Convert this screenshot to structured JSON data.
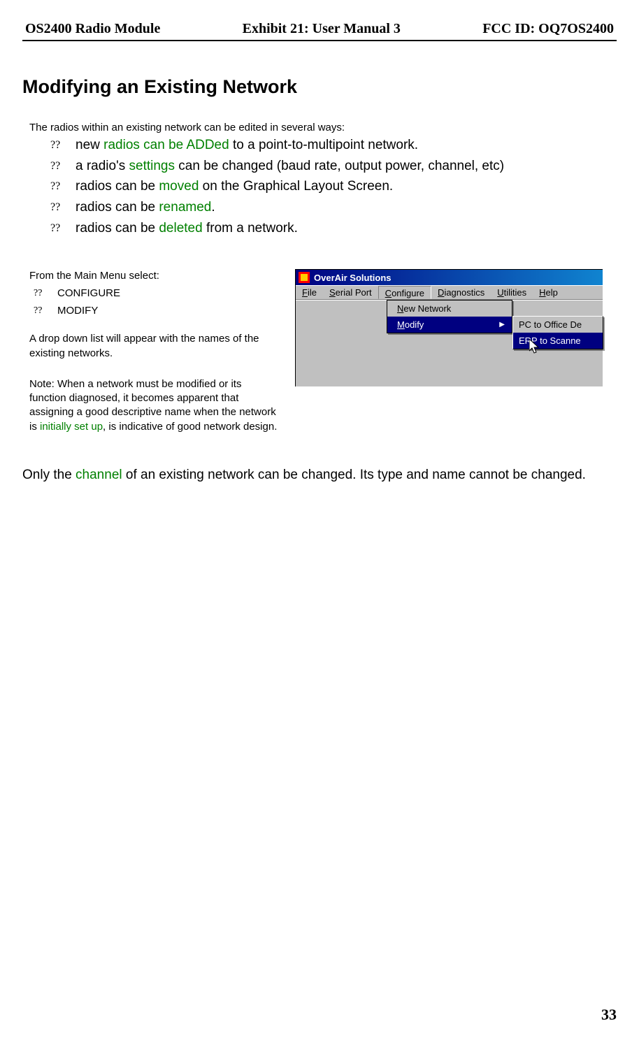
{
  "header": {
    "left": "OS2400 Radio Module",
    "center": "Exhibit 21: User Manual 3",
    "right": "FCC ID: OQ7OS2400"
  },
  "title": "Modifying an Existing Network",
  "intro": "The radios within an existing network can be edited in several ways:",
  "bullets": [
    {
      "marker": "??",
      "pre": "new ",
      "link": "radios can be ADDed",
      "post": " to a point-to-multipoint network."
    },
    {
      "marker": "??",
      "pre": "a radio's ",
      "link": "settings",
      "post": " can be changed (baud rate, output power, channel, etc)"
    },
    {
      "marker": "??",
      "pre": "radios can be ",
      "link": "moved",
      "post": " on the Graphical Layout Screen."
    },
    {
      "marker": "??",
      "pre": "radios can be ",
      "link": "renamed",
      "post": "."
    },
    {
      "marker": "??",
      "pre": "radios can be ",
      "link": "deleted",
      "post": " from a network."
    }
  ],
  "left": {
    "p1": "From the Main Menu select:",
    "steps": [
      {
        "marker": "??",
        "text": "CONFIGURE"
      },
      {
        "marker": "??",
        "text": "MODIFY"
      }
    ],
    "p2": "A drop down list will appear with the names of the existing networks.",
    "note_pre": "Note:   When a network must be modified or its function diagnosed, it becomes apparent that assigning a good descriptive name when the network is ",
    "note_link": "initially set up",
    "note_post": ", is indicative of good network design."
  },
  "app": {
    "title": "OverAir Solutions",
    "menu": {
      "file_u": "F",
      "file": "ile",
      "serial_u": "S",
      "serial": "erial Port",
      "configure_u": "C",
      "configure": "onfigure",
      "diag_u": "D",
      "diag": "iagnostics",
      "util_u": "U",
      "util": "tilities",
      "help_u": "H",
      "help": "elp"
    },
    "dropdown": {
      "item1_u": "N",
      "item1": "ew Network",
      "item2_u": "M",
      "item2": "odify"
    },
    "submenu": {
      "s1": "PC to Office De",
      "s2": "ERP to Scanne"
    }
  },
  "closing_pre": "Only the ",
  "closing_link": "channel",
  "closing_post": " of an existing network can be changed.  Its type and name cannot be changed.",
  "page_number": "33"
}
